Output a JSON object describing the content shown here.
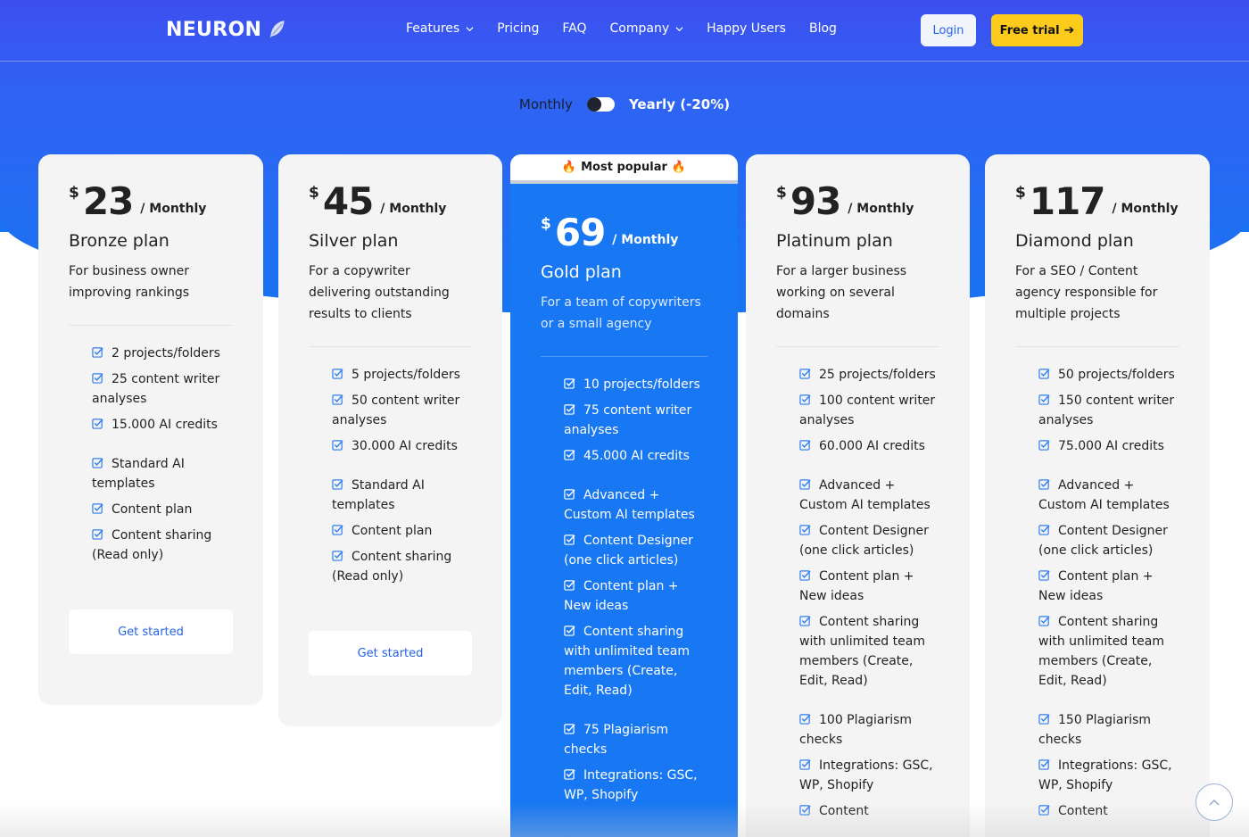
{
  "brand": {
    "name": "NEURON"
  },
  "nav": {
    "items": [
      {
        "label": "Features",
        "dropdown": true
      },
      {
        "label": "Pricing",
        "dropdown": false
      },
      {
        "label": "FAQ",
        "dropdown": false
      },
      {
        "label": "Company",
        "dropdown": true
      },
      {
        "label": "Happy Users",
        "dropdown": false
      },
      {
        "label": "Blog",
        "dropdown": false
      }
    ],
    "login_label": "Login",
    "trial_label": "Free trial"
  },
  "billing": {
    "monthly_label": "Monthly",
    "yearly_label": "Yearly (-20%)",
    "selected": "Monthly"
  },
  "popular": {
    "label": "Most popular"
  },
  "colors": {
    "accent": "#1877f2",
    "brand_start": "#3d4ff0",
    "cta_yellow": "#fccb1c",
    "check_blue": "#2f7df0"
  },
  "plans": [
    {
      "currency": "$",
      "price": "23",
      "period": "/ Monthly",
      "name": "Bronze plan",
      "description": "For business owner improving rankings",
      "groups": [
        [
          "2 projects/folders",
          "25 content writer analyses",
          "15.000 AI credits"
        ],
        [
          "Standard AI templates",
          "Content plan",
          "Content sharing (Read only)"
        ]
      ],
      "cta": "Get started"
    },
    {
      "currency": "$",
      "price": "45",
      "period": "/ Monthly",
      "name": "Silver plan",
      "description": "For a copywriter delivering outstanding results to clients",
      "groups": [
        [
          "5 projects/folders",
          "50 content writer analyses",
          "30.000 AI credits"
        ],
        [
          "Standard AI templates",
          "Content plan",
          "Content sharing (Read only)"
        ]
      ],
      "cta": "Get started"
    },
    {
      "currency": "$",
      "price": "69",
      "period": "/ Monthly",
      "name": "Gold plan",
      "description": "For a team of copywriters or a small agency",
      "groups": [
        [
          "10 projects/folders",
          "75 content writer analyses",
          "45.000 AI credits"
        ],
        [
          "Advanced + Custom AI templates",
          "Content Designer (one click articles)",
          "Content plan + New ideas",
          "Content sharing with unlimited team members (Create, Edit, Read)"
        ],
        [
          "75 Plagiarism checks",
          "Integrations: GSC, WP, Shopify"
        ]
      ]
    },
    {
      "currency": "$",
      "price": "93",
      "period": "/ Monthly",
      "name": "Platinum plan",
      "description": "For a larger business working on several domains",
      "groups": [
        [
          "25 projects/folders",
          "100 content writer analyses",
          "60.000 AI credits"
        ],
        [
          "Advanced + Custom AI templates",
          "Content Designer (one click articles)",
          "Content plan + New ideas",
          "Content sharing with unlimited team members (Create, Edit, Read)"
        ],
        [
          "100 Plagiarism checks",
          "Integrations: GSC, WP, Shopify",
          "Content"
        ]
      ]
    },
    {
      "currency": "$",
      "price": "117",
      "period": "/ Monthly",
      "name": "Diamond plan",
      "description": "For a SEO / Content agency responsible for multiple projects",
      "groups": [
        [
          "50 projects/folders",
          "150 content writer analyses",
          "75.000 AI credits"
        ],
        [
          "Advanced + Custom AI templates",
          "Content Designer (one click articles)",
          "Content plan + New ideas",
          "Content sharing with unlimited team members (Create, Edit, Read)"
        ],
        [
          "150 Plagiarism checks",
          "Integrations: GSC, WP, Shopify",
          "Content"
        ]
      ]
    }
  ]
}
